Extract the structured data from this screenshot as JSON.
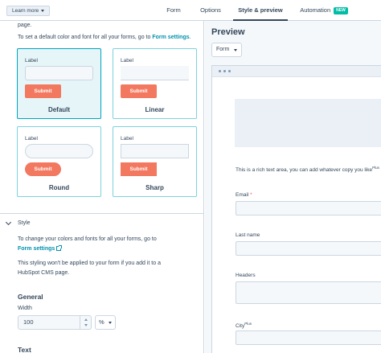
{
  "topbar": {
    "learn_more": "Learn more",
    "tabs": [
      {
        "label": "Form"
      },
      {
        "label": "Options"
      },
      {
        "label": "Style & preview"
      },
      {
        "label": "Automation"
      }
    ],
    "new_badge": "NEW"
  },
  "left": {
    "page_tail": "page.",
    "settings_text": "To set a default color and font for all your forms, go to",
    "settings_link": "Form settings",
    "settings_period": ".",
    "themes": [
      {
        "name": "Default",
        "label": "Label",
        "submit": "Submit"
      },
      {
        "name": "Linear",
        "label": "Label",
        "submit": "Submit"
      },
      {
        "name": "Round",
        "label": "Label",
        "submit": "Submit"
      },
      {
        "name": "Sharp",
        "label": "Label",
        "submit": "Submit"
      }
    ],
    "style_section": {
      "title": "Style",
      "desc1": "To change your colors and fonts for all your forms, go to",
      "desc_link": "Form settings",
      "desc2a": "This styling won't be applied to your form if you add it to a",
      "desc2b": "HubSpot CMS page."
    },
    "general": {
      "heading": "General",
      "width_label": "Width",
      "width_value": "100",
      "width_unit": "%"
    },
    "text_heading": "Text"
  },
  "preview": {
    "title": "Preview",
    "selector": "Form",
    "rich_text": "This is a rich text area, you can add whatever copy you like",
    "rich_text_sup": "Plus",
    "fields": [
      {
        "label": "Email",
        "required": "*"
      },
      {
        "label": "Last name"
      },
      {
        "label": "Headers"
      },
      {
        "label": "City",
        "sup": "Plus"
      }
    ]
  },
  "colors": {
    "accent": "#00a4bd",
    "submit": "#f2785f",
    "link": "#0091ae",
    "badge": "#00bda5"
  }
}
